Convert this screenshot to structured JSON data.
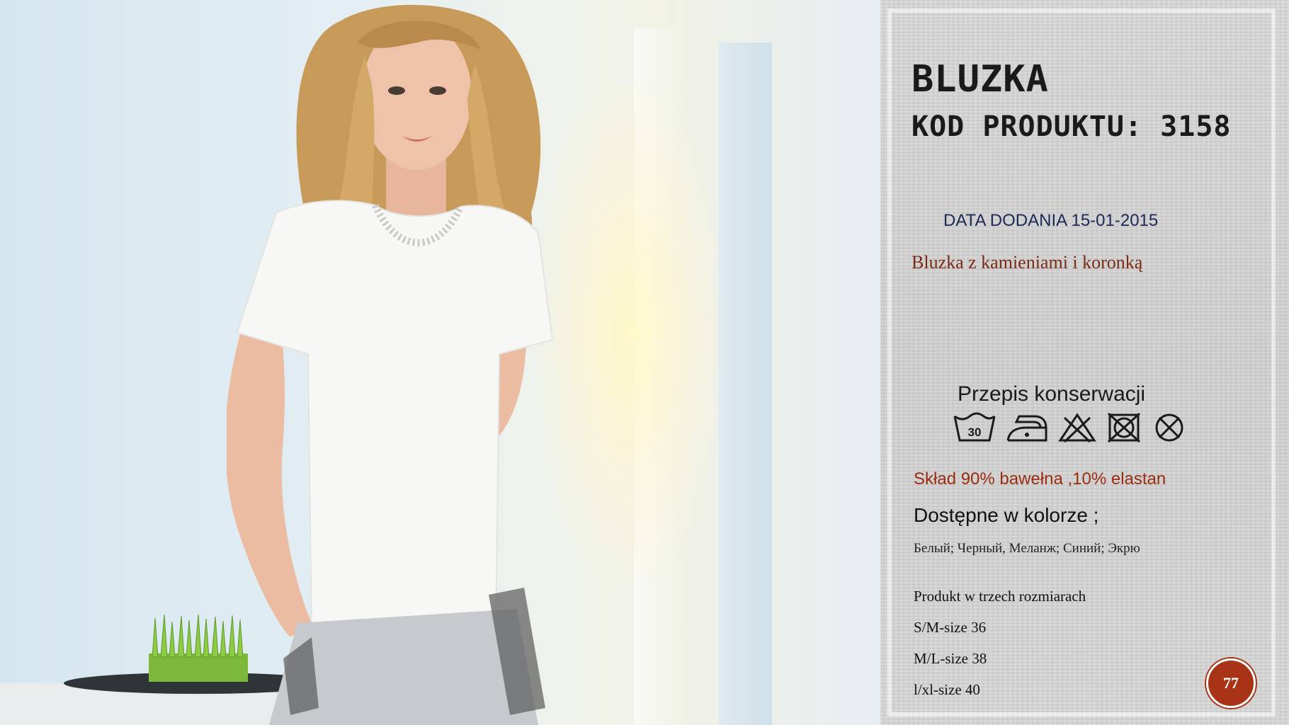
{
  "product": {
    "title": "BLUZKA",
    "code_line": "KOD PRODUKTU: 3158",
    "date_label": "DATA DODANIA",
    "date_value": "15-01-2015",
    "description": "Bluzka z kamieniami i koronką"
  },
  "care": {
    "title": "Przepis konserwacji",
    "wash_temp": "30",
    "icons": [
      "wash-30-icon",
      "iron-low-icon",
      "no-bleach-icon",
      "no-tumble-dry-icon",
      "no-dry-clean-icon"
    ]
  },
  "composition": "Skład  90% bawełna ,10% elastan",
  "colors": {
    "title": "Dostępne w  kolorze  ;",
    "list": "Белый; Черный, Меланж; Синий; Экрю"
  },
  "sizes": {
    "title": "Produkt w trzech rozmiarach",
    "items": [
      "S/M-size 36",
      "M/L-size 38",
      "l/xl-size 40"
    ]
  },
  "page_number": "77",
  "theme": {
    "accent": "#a83317",
    "date_color": "#1c2a55",
    "desc_color": "#7a2a12",
    "composition_color": "#9a2d10"
  }
}
